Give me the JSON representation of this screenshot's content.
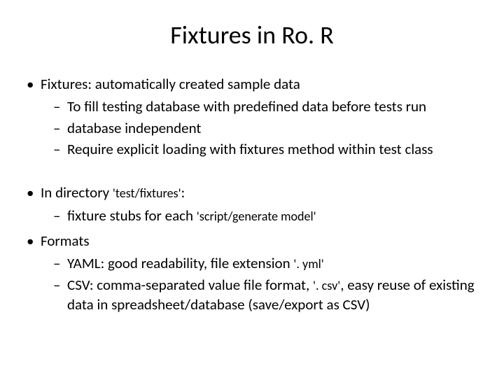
{
  "title": "Fixtures in Ro. R",
  "bullets": {
    "group1": {
      "main": "Fixtures: automatically created sample data",
      "subs": [
        "To fill testing database with predefined data before tests run",
        "database independent",
        "Require explicit loading with fixtures method within test class"
      ]
    },
    "group2": {
      "prefix": "In directory ",
      "code": "'test/fixtures'",
      "suffix": ":",
      "sub_prefix": "fixture stubs for each ",
      "sub_code": "'script/generate model'"
    },
    "group3": {
      "main": "Formats",
      "yaml_prefix": "YAML: good readability, file extension ",
      "yaml_code": "'. yml'",
      "csv_prefix": "CSV: comma-separated value file format, ",
      "csv_code": "'. csv'",
      "csv_suffix": ", easy reuse of existing data in spreadsheet/database (save/export as CSV)"
    }
  }
}
